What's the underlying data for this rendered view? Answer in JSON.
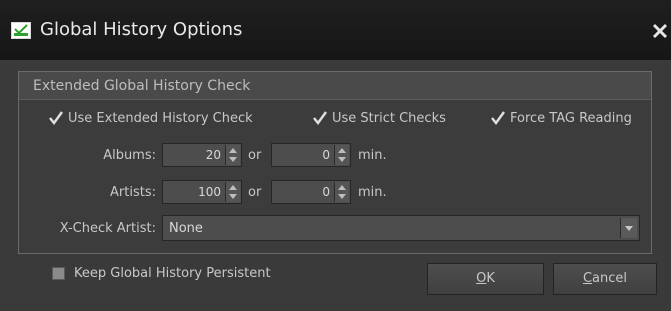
{
  "window": {
    "title": "Global History Options"
  },
  "group": {
    "title": "Extended Global History Check"
  },
  "options": {
    "use_extended": {
      "label": "Use Extended History Check",
      "checked": true
    },
    "use_strict": {
      "label": "Use Strict Checks",
      "checked": true
    },
    "force_tag": {
      "label": "Force TAG Reading",
      "checked": true
    }
  },
  "albums": {
    "label": "Albums:",
    "count": "20",
    "or": "or",
    "minutes": "0",
    "unit": "min."
  },
  "artists": {
    "label": "Artists:",
    "count": "100",
    "or": "or",
    "minutes": "0",
    "unit": "min."
  },
  "xcheck": {
    "label": "X-Check Artist:",
    "value": "None"
  },
  "persistent": {
    "label": "Keep Global History Persistent",
    "checked": false
  },
  "buttons": {
    "ok_mnemonic": "O",
    "ok_rest": "K",
    "cancel_mnemonic": "C",
    "cancel_rest": "ancel"
  },
  "colors": {
    "accent_check": "#2fa12f",
    "titlebar": "#1a1a1a",
    "dialog_bg": "#3a3a3a"
  },
  "icons": {
    "app": "checkmark-icon",
    "close": "close-icon",
    "check": "check-mark-icon",
    "spin": "spin-arrows-icon",
    "dropdown": "chevron-down-icon"
  }
}
